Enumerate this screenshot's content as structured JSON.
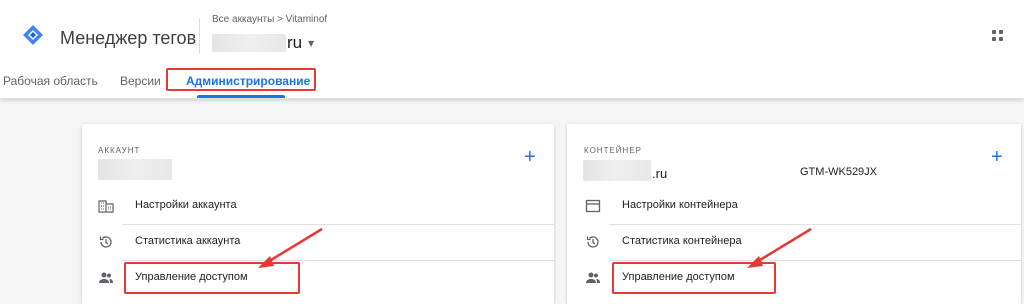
{
  "header": {
    "app_title": "Менеджер тегов",
    "breadcrumb": "Все аккаунты > Vitaminof",
    "container_suffix": "ru",
    "dropdown_caret": "▾"
  },
  "tabs": [
    {
      "label": "Рабочая область"
    },
    {
      "label": "Версии"
    },
    {
      "label": "Администрирование"
    }
  ],
  "account_card": {
    "label": "АККАУНТ",
    "plus": "+",
    "rows": [
      {
        "label": "Настройки аккаунта",
        "icon": "building-icon"
      },
      {
        "label": "Статистика аккаунта",
        "icon": "history-icon"
      },
      {
        "label": "Управление доступом",
        "icon": "people-icon"
      }
    ]
  },
  "container_card": {
    "label": "КОНТЕЙНЕР",
    "plus": "+",
    "name_suffix": ".ru",
    "container_id": "GTM-WK529JX",
    "rows": [
      {
        "label": "Настройки контейнера",
        "icon": "window-icon"
      },
      {
        "label": "Статистика контейнера",
        "icon": "history-icon"
      },
      {
        "label": "Управление доступом",
        "icon": "people-icon"
      }
    ]
  },
  "colors": {
    "accent": "#1a73e8",
    "highlight": "#e53935",
    "background": "#f5f5f5"
  }
}
